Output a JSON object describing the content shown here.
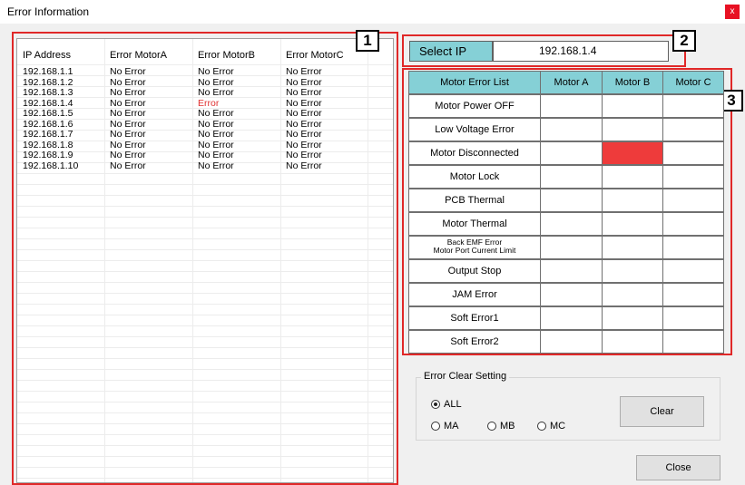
{
  "window": {
    "title": "Error Information",
    "close_glyph": "x"
  },
  "error_table": {
    "columns": [
      "IP Address",
      "Error MotorA",
      "Error MotorB",
      "Error MotorC"
    ],
    "rows": [
      [
        "192.168.1.1",
        "No Error",
        "No Error",
        "No Error"
      ],
      [
        "192.168.1.2",
        "No Error",
        "No Error",
        "No Error"
      ],
      [
        "192.168.1.3",
        "No Error",
        "No Error",
        "No Error"
      ],
      [
        "192.168.1.4",
        "No Error",
        "Error",
        "No Error"
      ],
      [
        "192.168.1.5",
        "No Error",
        "No Error",
        "No Error"
      ],
      [
        "192.168.1.6",
        "No Error",
        "No Error",
        "No Error"
      ],
      [
        "192.168.1.7",
        "No Error",
        "No Error",
        "No Error"
      ],
      [
        "192.168.1.8",
        "No Error",
        "No Error",
        "No Error"
      ],
      [
        "192.168.1.9",
        "No Error",
        "No Error",
        "No Error"
      ],
      [
        "192.168.1.10",
        "No Error",
        "No Error",
        "No Error"
      ]
    ]
  },
  "select_ip": {
    "label": "Select IP",
    "value": "192.168.1.4"
  },
  "motor_error_list": {
    "headers": [
      "Motor Error List",
      "Motor A",
      "Motor B",
      "Motor C"
    ],
    "rows": [
      {
        "label": "Motor Power OFF",
        "active": [
          false,
          false,
          false
        ]
      },
      {
        "label": "Low Voltage Error",
        "active": [
          false,
          false,
          false
        ]
      },
      {
        "label": "Motor Disconnected",
        "active": [
          false,
          true,
          false
        ]
      },
      {
        "label": "Motor Lock",
        "active": [
          false,
          false,
          false
        ]
      },
      {
        "label": "PCB Thermal",
        "active": [
          false,
          false,
          false
        ]
      },
      {
        "label": "Motor Thermal",
        "active": [
          false,
          false,
          false
        ]
      },
      {
        "label": "Back EMF Error\nMotor Port Current Limit",
        "active": [
          false,
          false,
          false
        ]
      },
      {
        "label": "Output Stop",
        "active": [
          false,
          false,
          false
        ]
      },
      {
        "label": "JAM Error",
        "active": [
          false,
          false,
          false
        ]
      },
      {
        "label": "Soft Error1",
        "active": [
          false,
          false,
          false
        ]
      },
      {
        "label": "Soft Error2",
        "active": [
          false,
          false,
          false
        ]
      }
    ]
  },
  "error_clear": {
    "title": "Error Clear Setting",
    "options": [
      "ALL",
      "MA",
      "MB",
      "MC"
    ],
    "selected": "ALL",
    "clear_label": "Clear"
  },
  "close_label": "Close",
  "annotations": [
    "1",
    "2",
    "3"
  ],
  "colors": {
    "header_teal": "#85d0d6",
    "error_red": "#ee3b3b",
    "annotation_red": "#e02828"
  }
}
